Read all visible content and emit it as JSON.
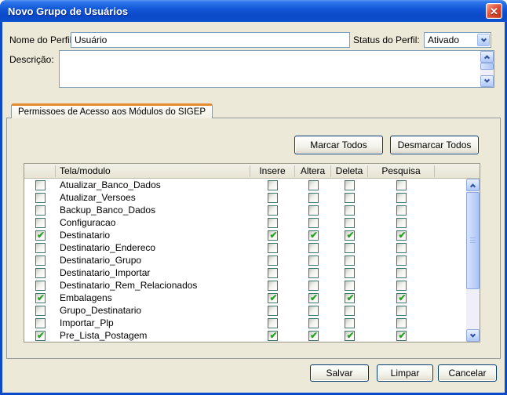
{
  "window": {
    "title": "Novo Grupo de Usuários",
    "close_icon": "✕"
  },
  "form": {
    "name_label": "Nome do Perfil:",
    "name_value": "Usuário",
    "status_label": "Status do Perfil:",
    "status_value": "Ativado",
    "description_label": "Descrição:",
    "description_value": ""
  },
  "tab": {
    "label": "Permissoes de Acesso aos Módulos do SIGEP"
  },
  "toolbar": {
    "mark_all_label": "Marcar Todos",
    "unmark_all_label": "Desmarcar Todos"
  },
  "table": {
    "columns": {
      "module": "Tela/modulo",
      "insere": "Insere",
      "altera": "Altera",
      "deleta": "Deleta",
      "pesquisa": "Pesquisa"
    },
    "rows": [
      {
        "name": "Atualizar_Banco_Dados",
        "selected": false,
        "insere": false,
        "altera": false,
        "deleta": false,
        "pesquisa": false
      },
      {
        "name": "Atualizar_Versoes",
        "selected": false,
        "insere": false,
        "altera": false,
        "deleta": false,
        "pesquisa": false
      },
      {
        "name": "Backup_Banco_Dados",
        "selected": false,
        "insere": false,
        "altera": false,
        "deleta": false,
        "pesquisa": false
      },
      {
        "name": "Configuracao",
        "selected": false,
        "insere": false,
        "altera": false,
        "deleta": false,
        "pesquisa": false
      },
      {
        "name": "Destinatario",
        "selected": true,
        "insere": true,
        "altera": true,
        "deleta": true,
        "pesquisa": true
      },
      {
        "name": "Destinatario_Endereco",
        "selected": false,
        "insere": false,
        "altera": false,
        "deleta": false,
        "pesquisa": false
      },
      {
        "name": "Destinatario_Grupo",
        "selected": false,
        "insere": false,
        "altera": false,
        "deleta": false,
        "pesquisa": false
      },
      {
        "name": "Destinatario_Importar",
        "selected": false,
        "insere": false,
        "altera": false,
        "deleta": false,
        "pesquisa": false
      },
      {
        "name": "Destinatario_Rem_Relacionados",
        "selected": false,
        "insere": false,
        "altera": false,
        "deleta": false,
        "pesquisa": false
      },
      {
        "name": "Embalagens",
        "selected": true,
        "insere": true,
        "altera": true,
        "deleta": true,
        "pesquisa": true
      },
      {
        "name": "Grupo_Destinatario",
        "selected": false,
        "insere": false,
        "altera": false,
        "deleta": false,
        "pesquisa": false
      },
      {
        "name": "Importar_Plp",
        "selected": false,
        "insere": false,
        "altera": false,
        "deleta": false,
        "pesquisa": false
      },
      {
        "name": "Pre_Lista_Postagem",
        "selected": true,
        "insere": true,
        "altera": true,
        "deleta": true,
        "pesquisa": true
      }
    ]
  },
  "footer": {
    "save_label": "Salvar",
    "clear_label": "Limpar",
    "cancel_label": "Cancelar"
  },
  "colors": {
    "titlebar_blue": "#1257D8",
    "frame_blue": "#0B4ACA",
    "dialog_bg": "#ECE9D8",
    "tab_accent_orange": "#E68B2C",
    "input_border": "#7F9DB9",
    "check_green": "#27A327",
    "close_red": "#D8452D"
  }
}
